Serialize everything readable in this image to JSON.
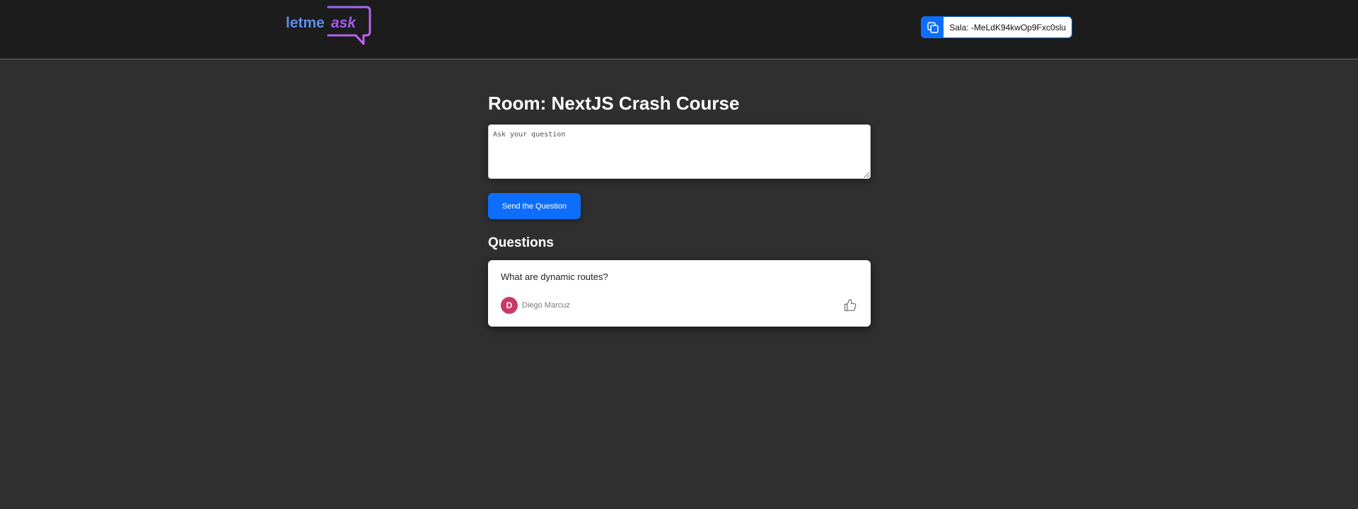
{
  "header": {
    "logo": {
      "text_primary": "letme",
      "text_secondary": "ask"
    },
    "room_code": {
      "label": "Sala: -MeLdK94kwOp9Fxc0slu"
    }
  },
  "main": {
    "title": "Room: NextJS Crash Course",
    "question_input": {
      "placeholder": "Ask your question",
      "value": ""
    },
    "send_button_label": "Send the Question",
    "questions_heading": "Questions",
    "questions": [
      {
        "text": "What are dynamic routes?",
        "author": {
          "name": "Diego Marcuz",
          "initial": "D"
        }
      }
    ]
  },
  "icons": {
    "copy": "copy-icon",
    "like": "thumbs-up-icon"
  },
  "colors": {
    "header_bg": "#1c1c1c",
    "page_bg": "#2f2f2f",
    "accent": "#0d6efd",
    "logo_blue": "#5a8dee",
    "logo_purple": "#a35cf0",
    "avatar_bg": "#c8386b"
  }
}
